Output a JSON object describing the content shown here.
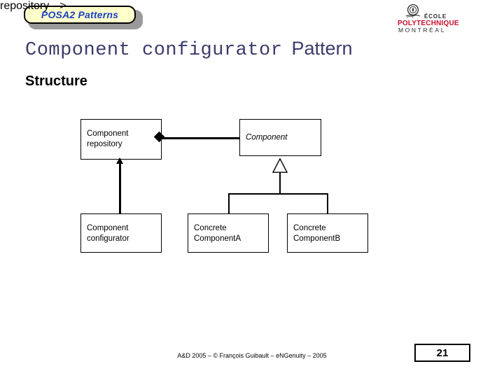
{
  "badge": {
    "label": "POSA2 Patterns",
    "fill_color": "#ffffcc",
    "text_color": "#1a3fc4",
    "border_color": "#000000",
    "shadow_color": "#9a9a9a"
  },
  "logo": {
    "icon": "polytechnique-crest-icon",
    "line1": "ÉCOLE",
    "line2": "POLYTECHNIQUE",
    "line3": "MONTRÉAL",
    "accent_color": "#c8102e"
  },
  "title": {
    "monospace_part": "Component configurator",
    "suffix_part": "Pattern",
    "color": "#3b3b6b"
  },
  "section": {
    "heading": "Structure"
  },
  "diagram": {
    "type": "uml-class-diagram",
    "boxes": [
      {
        "id": "repository",
        "label": "Component\nrepository",
        "italic": false
      },
      {
        "id": "component",
        "label": "Component",
        "italic": true
      },
      {
        "id": "configurator",
        "label": "Component\nconfigurator",
        "italic": false
      },
      {
        "id": "concreteA",
        "label": "Concrete\nComponentA",
        "italic": false
      },
      {
        "id": "concreteB",
        "label": "Concrete\nComponentB",
        "italic": false
      }
    ],
    "relations": [
      {
        "kind": "composition",
        "from": "repository",
        "to": "component",
        "adornment": "filled-diamond"
      },
      {
        "kind": "association",
        "from": "configurator",
        "to": "repository",
        "adornment": "filled-arrow"
      },
      {
        "kind": "generalization",
        "from": "concreteA",
        "to": "component",
        "adornment": "hollow-triangle"
      },
      {
        "kind": "generalization",
        "from": "concreteB",
        "to": "component",
        "adornment": "hollow-triangle"
      }
    ]
  },
  "footer": {
    "credit": "A&D 2005 – ©  François Guibault – eNGenuity – 2005",
    "page_number": "21"
  }
}
